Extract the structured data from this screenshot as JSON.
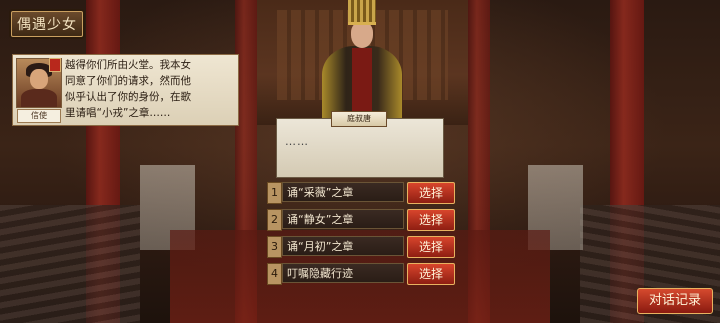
{
  "header": {
    "title": "偶遇少女"
  },
  "npc": {
    "name": "信使",
    "icon": "portrait-icon",
    "dialog_lines": [
      "越得你们所由火堂。我本女",
      "同意了你们的请求，然而他",
      "似乎认出了你的身份，在歌",
      "里请唱“小戎”之章……"
    ]
  },
  "speaker": {
    "name": "庭叔唐",
    "text": "……"
  },
  "options": [
    {
      "num": "1",
      "text": "诵“采薇”之章",
      "button": "选择"
    },
    {
      "num": "2",
      "text": "诵“静女”之章",
      "button": "选择"
    },
    {
      "num": "3",
      "text": "诵“月初”之章",
      "button": "选择"
    },
    {
      "num": "4",
      "text": "叮嘱隐藏行迹",
      "button": "选择"
    }
  ],
  "footer": {
    "log_button": "对话记录"
  },
  "colors": {
    "accent": "#c8301e",
    "panel": "#e8dfcc",
    "gold": "#e8b260"
  }
}
